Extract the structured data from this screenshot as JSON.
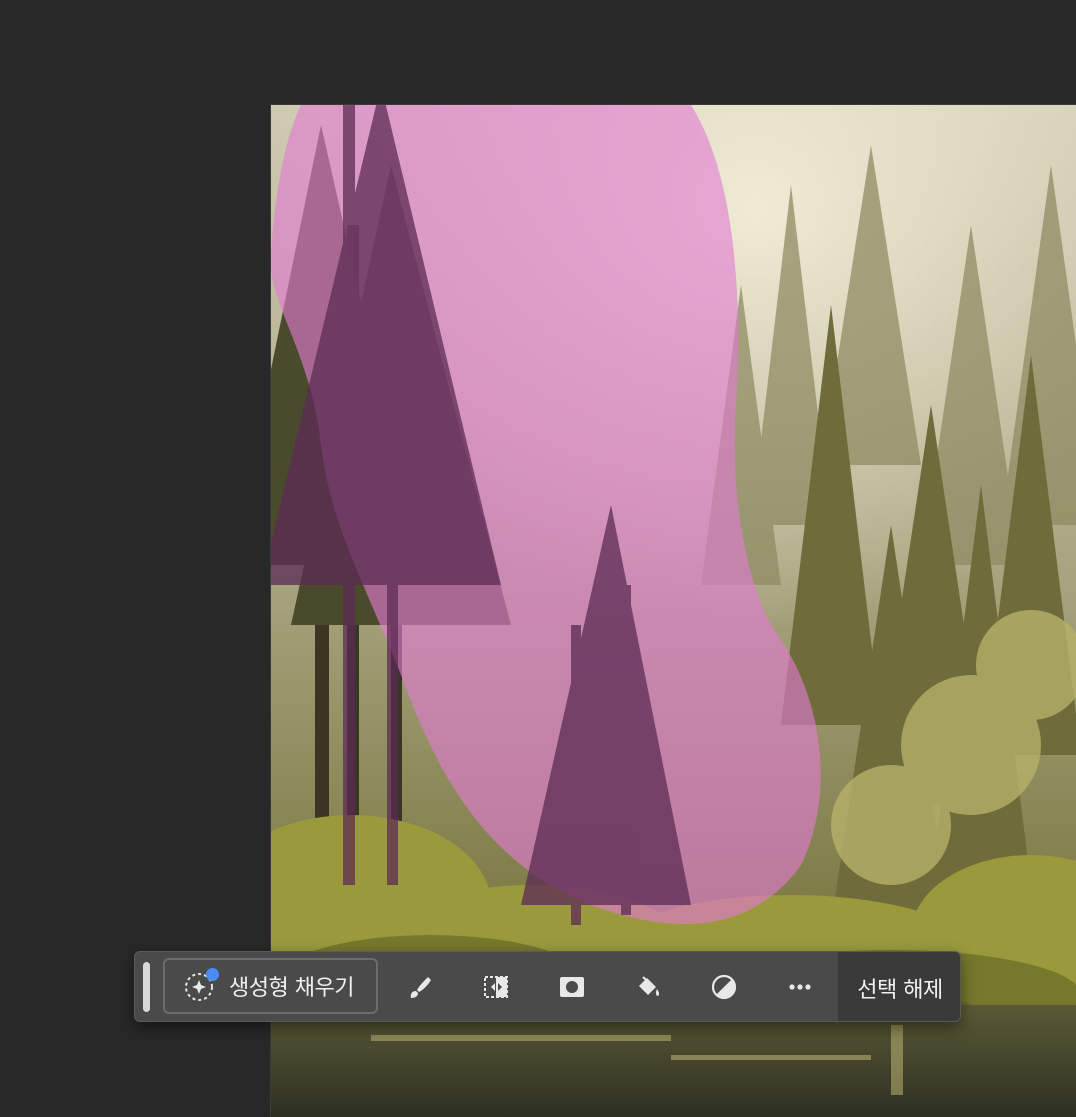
{
  "canvas": {
    "image_description_name": "forest-lake-photo",
    "selection_overlay_color": "#e27ad2"
  },
  "taskbar": {
    "generative_fill_label": "생성형 채우기",
    "deselect_label": "선택 해제",
    "tools": [
      {
        "name": "modify-selection-icon"
      },
      {
        "name": "invert-selection-icon"
      },
      {
        "name": "create-mask-icon"
      },
      {
        "name": "fill-bucket-icon"
      },
      {
        "name": "adjustment-layer-icon"
      },
      {
        "name": "more-options-icon"
      }
    ],
    "accent_color": "#4b8bf5"
  }
}
